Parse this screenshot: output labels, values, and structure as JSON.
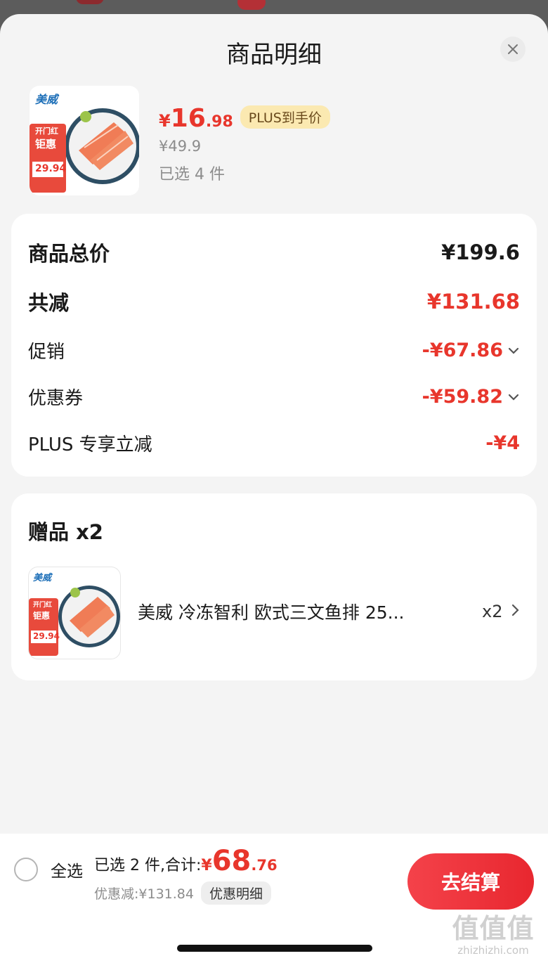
{
  "modal": {
    "title": "商品明细",
    "close_icon": "close-icon"
  },
  "product": {
    "image_brand": "美威",
    "image_badge": "开门红",
    "image_badge2": "钜惠",
    "image_price": "29.94",
    "price_symbol": "¥",
    "price_int": "16",
    "price_dec": ".98",
    "plus_tag": "PLUS到手价",
    "original_price": "¥49.9",
    "selected_count": "已选 4 件"
  },
  "summary": {
    "goods_total_label": "商品总价",
    "goods_total_value": "¥199.6",
    "total_reduce_label": "共减",
    "total_reduce_value": "¥131.68",
    "promo_label": "促销",
    "promo_value": "-¥67.86",
    "coupon_label": "优惠券",
    "coupon_value": "-¥59.82",
    "plus_label": "PLUS 专享立减",
    "plus_value": "-¥4"
  },
  "gift": {
    "title": "赠品 x2",
    "name": "美威 冷冻智利 欧式三文鱼排 25...",
    "qty": "x2"
  },
  "footer": {
    "select_all": "全选",
    "selected_text": "已选 2 件,合计:",
    "sum_symbol": "¥",
    "sum_int": "68",
    "sum_dec": ".76",
    "discount_text": "优惠减:¥131.84",
    "detail_label": "优惠明细",
    "checkout_label": "去结算"
  },
  "watermark": {
    "big": "值值值",
    "small": "zhizhizhi.com"
  },
  "colors": {
    "accent_red": "#e8362c",
    "plus_tag_bg": "#fbe9b1",
    "sheet_bg": "#f4f4f4"
  }
}
